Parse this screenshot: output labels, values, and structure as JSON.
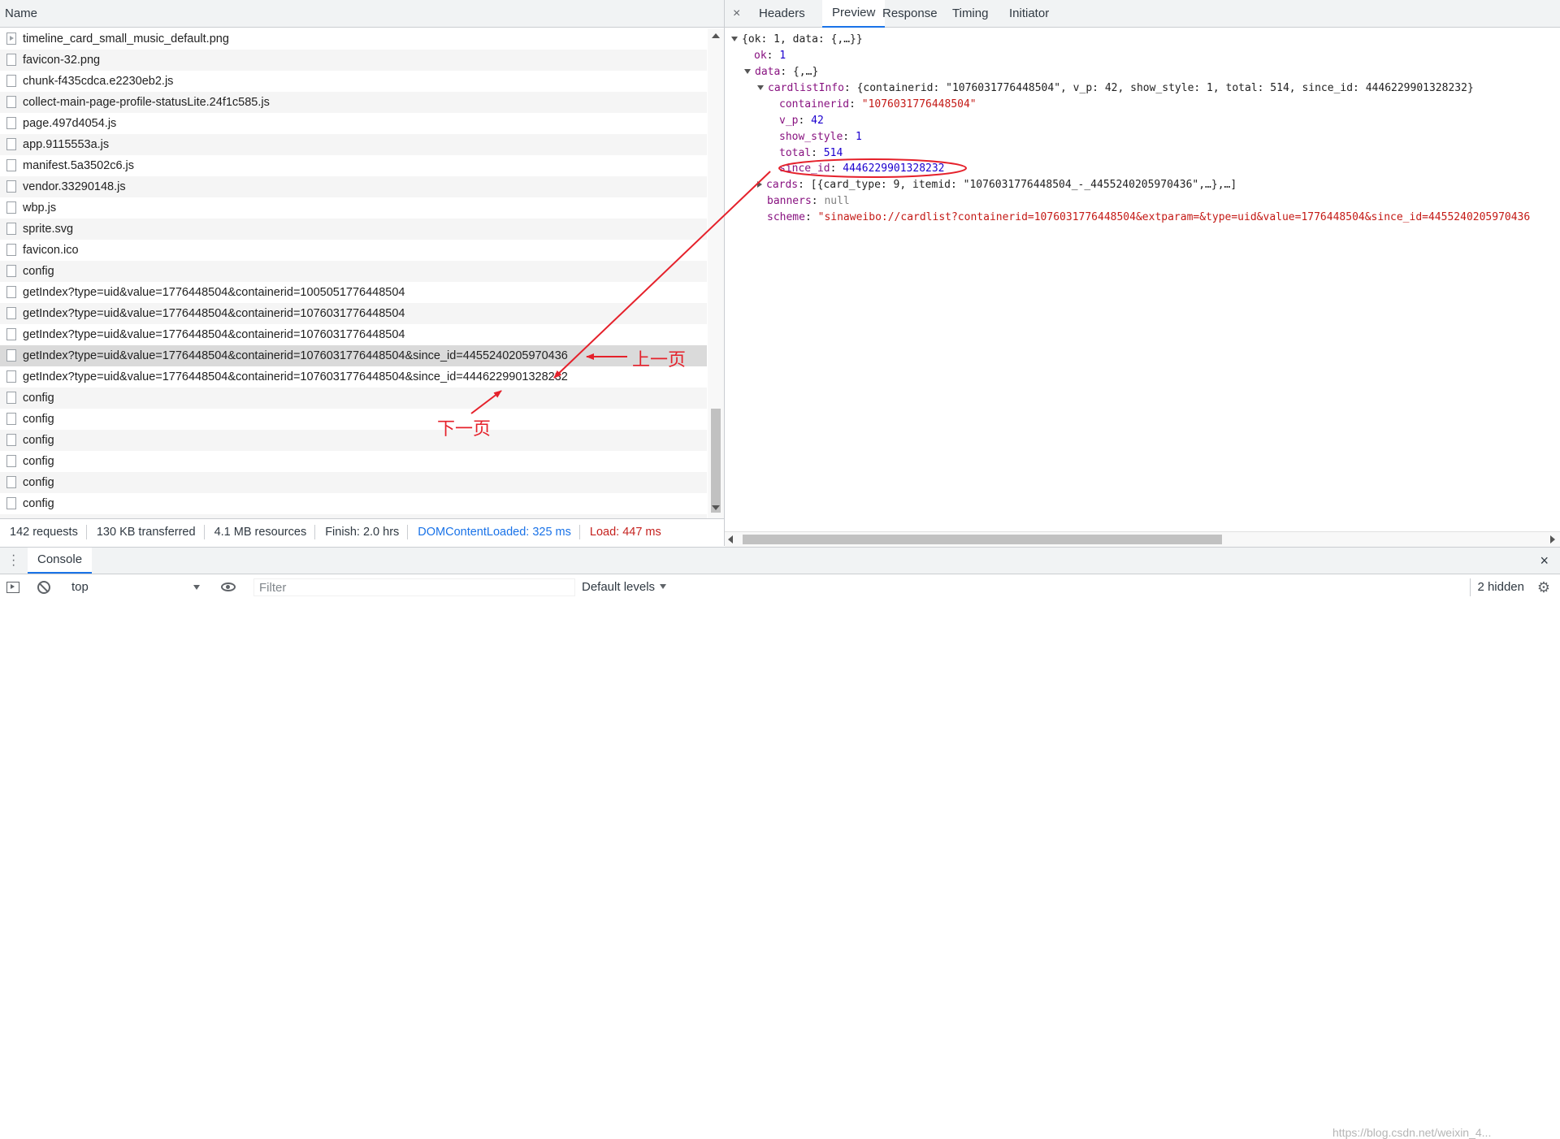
{
  "network": {
    "name_header": "Name",
    "rows": [
      {
        "name": "timeline_card_small_music_default.png",
        "icon": "image-file-icon"
      },
      {
        "name": "favicon-32.png",
        "icon": "file-icon"
      },
      {
        "name": "chunk-f435cdca.e2230eb2.js",
        "icon": "file-icon"
      },
      {
        "name": "collect-main-page-profile-statusLite.24f1c585.js",
        "icon": "file-icon"
      },
      {
        "name": "page.497d4054.js",
        "icon": "file-icon"
      },
      {
        "name": "app.9115553a.js",
        "icon": "file-icon"
      },
      {
        "name": "manifest.5a3502c6.js",
        "icon": "file-icon"
      },
      {
        "name": "vendor.33290148.js",
        "icon": "file-icon"
      },
      {
        "name": "wbp.js",
        "icon": "file-icon"
      },
      {
        "name": "sprite.svg",
        "icon": "file-icon"
      },
      {
        "name": "favicon.ico",
        "icon": "file-icon"
      },
      {
        "name": "config",
        "icon": "file-icon"
      },
      {
        "name": "getIndex?type=uid&value=1776448504&containerid=1005051776448504",
        "icon": "file-icon"
      },
      {
        "name": "getIndex?type=uid&value=1776448504&containerid=1076031776448504",
        "icon": "file-icon"
      },
      {
        "name": "getIndex?type=uid&value=1776448504&containerid=1076031776448504",
        "icon": "file-icon"
      },
      {
        "name": "getIndex?type=uid&value=1776448504&containerid=1076031776448504&since_id=4455240205970436",
        "icon": "file-icon",
        "selected": true
      },
      {
        "name": "getIndex?type=uid&value=1776448504&containerid=1076031776448504&since_id=4446229901328232",
        "icon": "file-icon"
      },
      {
        "name": "config",
        "icon": "file-icon"
      },
      {
        "name": "config",
        "icon": "file-icon"
      },
      {
        "name": "config",
        "icon": "file-icon"
      },
      {
        "name": "config",
        "icon": "file-icon"
      },
      {
        "name": "config",
        "icon": "file-icon"
      },
      {
        "name": "config",
        "icon": "file-icon"
      },
      {
        "name": "",
        "icon": "file-icon"
      }
    ],
    "summary": {
      "requests": "142 requests",
      "transferred": "130 KB transferred",
      "resources": "4.1 MB resources",
      "finish": "Finish: 2.0 hrs",
      "dom_loaded": "DOMContentLoaded: 325 ms",
      "load": "Load: 447 ms"
    }
  },
  "detail": {
    "close": "×",
    "tabs": [
      "Headers",
      "Preview",
      "Response",
      "Timing",
      "Initiator"
    ],
    "active_tab": "Preview",
    "tree": {
      "root": "{ok: 1, data: {,…}}",
      "ok_key": "ok",
      "ok_val": "1",
      "data_key": "data",
      "data_summary": "{,…}",
      "cardlistInfo_key": "cardlistInfo",
      "cardlistInfo_summary": "{containerid: \"1076031776448504\", v_p: 42, show_style: 1, total: 514, since_id: 4446229901328232}",
      "containerid_key": "containerid",
      "containerid_val": "\"1076031776448504\"",
      "vp_key": "v_p",
      "vp_val": "42",
      "show_style_key": "show_style",
      "show_style_val": "1",
      "total_key": "total",
      "total_val": "514",
      "since_key": "since_id",
      "since_val": "4446229901328232",
      "cards_key": "cards",
      "cards_summary": "[{card_type: 9, itemid: \"1076031776448504_-_4455240205970436\",…},…]",
      "banners_key": "banners",
      "banners_val": "null",
      "scheme_key": "scheme",
      "scheme_val": "\"sinaweibo://cardlist?containerid=1076031776448504&extparam=&type=uid&value=1776448504&since_id=4455240205970436"
    }
  },
  "drawer": {
    "tab": "Console",
    "close": "×",
    "context": "top",
    "filter_placeholder": "Filter",
    "levels": "Default levels",
    "hidden": "2 hidden",
    "watermark": "https://blog.csdn.net/weixin_4..."
  },
  "annotations": {
    "prev_page": "上一页",
    "next_page": "下一页",
    "color": "#e5212b"
  }
}
